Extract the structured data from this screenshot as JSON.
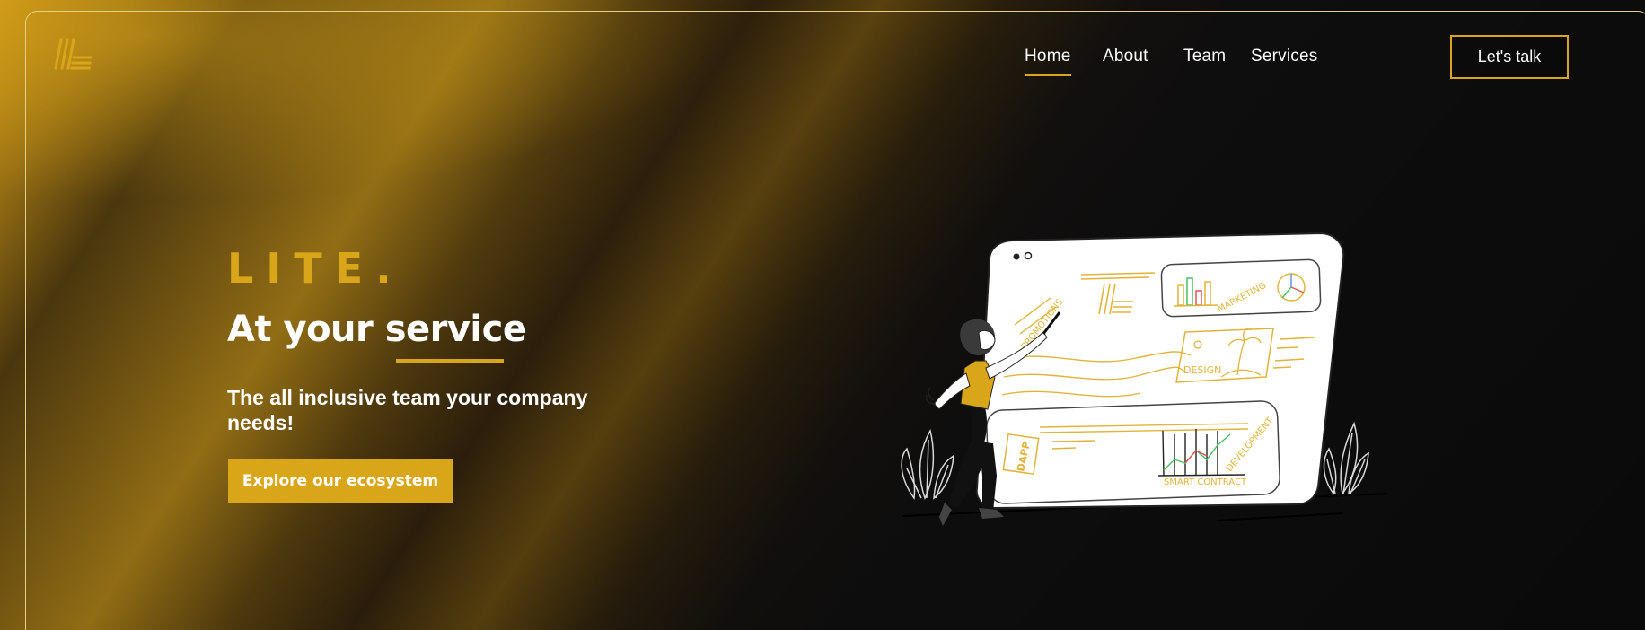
{
  "header": {
    "logo_icon": "stripes-logo-icon",
    "nav": [
      {
        "label": "Home",
        "active": true
      },
      {
        "label": "About",
        "active": false
      },
      {
        "label": "Team",
        "active": false
      },
      {
        "label": "Services",
        "active": false
      }
    ],
    "cta_label": "Let's talk"
  },
  "hero": {
    "brand": "LITE.",
    "headline": "At your service",
    "subheadline": "The all inclusive team your company needs!",
    "button_label": "Explore our ecosystem"
  },
  "illustration": {
    "labels": {
      "promotions": "PROMOTIONS",
      "marketing": "MARKETING",
      "design": "DESIGN",
      "dapp": "DAPP",
      "development": "DEVELOPMENT",
      "smart_contract": "SMART CONTRACT"
    }
  },
  "colors": {
    "accent": "#d9a61a",
    "background": "#121212",
    "text": "#ffffff"
  }
}
